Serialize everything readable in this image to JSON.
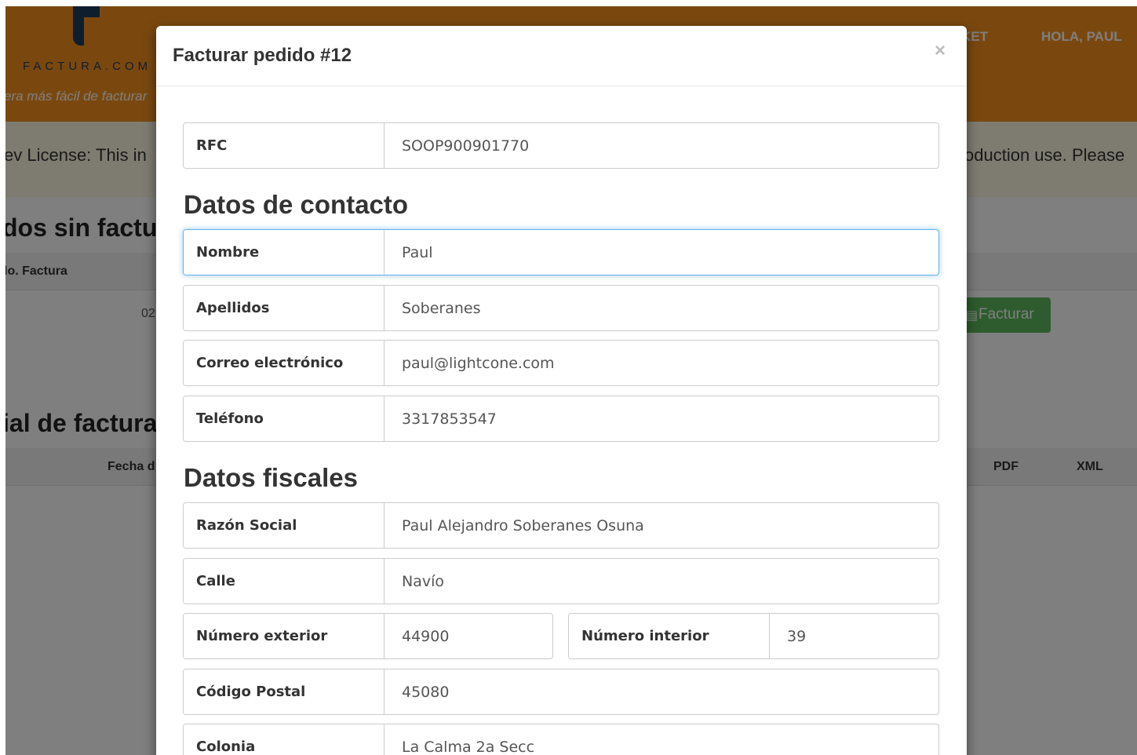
{
  "background": {
    "logo_text": "FACTURA.COM",
    "tagline": "era más fácil de facturar",
    "nav": {
      "ticket": "KET",
      "user": "HOLA, PAUL"
    },
    "license_left": "ev License: This in",
    "license_right": "oduction use. Please",
    "section1_title": "dos sin factu",
    "section1_col": "lo. Factura",
    "row_value": "02",
    "facturar_label": "Facturar",
    "section2_title": "ial de factura",
    "section2_cols": {
      "fecha": "Fecha d",
      "pdf": "PDF",
      "xml": "XML"
    }
  },
  "modal": {
    "title": "Facturar pedido #12",
    "close": "×",
    "rfc": {
      "label": "RFC",
      "value": "SOOP900901770"
    },
    "contacto": {
      "heading": "Datos de contacto",
      "nombre": {
        "label": "Nombre",
        "value": "Paul"
      },
      "apellidos": {
        "label": "Apellidos",
        "value": "Soberanes"
      },
      "correo": {
        "label": "Correo electrónico",
        "value": "paul@lightcone.com"
      },
      "telefono": {
        "label": "Teléfono",
        "value": "3317853547"
      }
    },
    "fiscales": {
      "heading": "Datos fiscales",
      "razon": {
        "label": "Razón Social",
        "value": "Paul Alejandro Soberanes Osuna"
      },
      "calle": {
        "label": "Calle",
        "value": "Navío"
      },
      "num_ext": {
        "label": "Número exterior",
        "value": "44900"
      },
      "num_int": {
        "label": "Número interior",
        "value": "39"
      },
      "cp": {
        "label": "Código Postal",
        "value": "45080"
      },
      "colonia": {
        "label": "Colonia",
        "value": "La Calma 2a Secc"
      }
    }
  }
}
